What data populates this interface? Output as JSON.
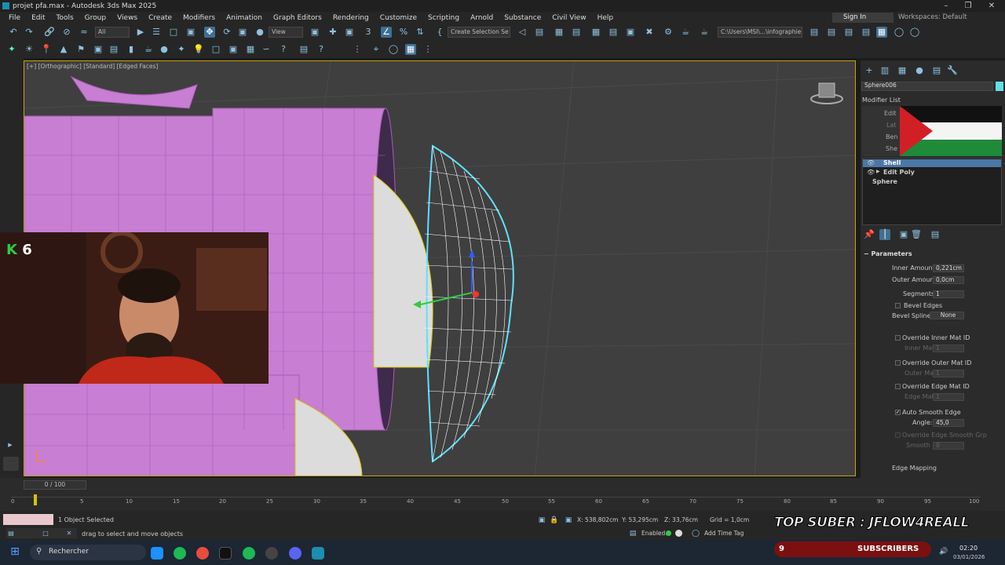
{
  "window": {
    "title": "projet pfa.max - Autodesk 3ds Max 2025"
  },
  "menus": [
    "File",
    "Edit",
    "Tools",
    "Group",
    "Views",
    "Create",
    "Modifiers",
    "Animation",
    "Graph Editors",
    "Rendering",
    "Customize",
    "Scripting",
    "Arnold",
    "Substance",
    "Civil View",
    "Help"
  ],
  "account": {
    "signin": "Sign In",
    "workspaces": "Workspaces:  Default"
  },
  "toolbar": {
    "filter": "All",
    "ref_coord": "View",
    "selection_set": "Create Selection Se",
    "path": "C:\\Users\\MSI\\...\\infographie"
  },
  "viewport": {
    "label": "[+] [Orthographic] [Standard] [Edged Faces]"
  },
  "webcam": {
    "count": "6"
  },
  "command_panel": {
    "object_name": "Sphere006",
    "modifier_list": "Modifier List",
    "stack": [
      "Shell",
      "Edit Poly",
      "Sphere"
    ],
    "stack_buttons": [
      "Edit",
      "Lat",
      "Ben",
      "She"
    ],
    "rollout": "Parameters",
    "inner_amount_label": "Inner Amount:",
    "inner_amount": "0,221cm",
    "outer_amount_label": "Outer Amount:",
    "outer_amount": "0,0cm",
    "segments_label": "Segments:",
    "segments": "1",
    "bevel_edges": "Bevel Edges",
    "bevel_spline_label": "Bevel Spline:",
    "bevel_spline": "None",
    "override_inner": "Override Inner Mat ID",
    "inner_mat_label": "Inner Mat ID:",
    "inner_mat": "1",
    "override_outer": "Override Outer Mat ID",
    "outer_mat_label": "Outer Mat ID:",
    "outer_mat": "1",
    "override_edge": "Override Edge Mat ID",
    "edge_mat_label": "Edge Mat ID:",
    "edge_mat": "1",
    "auto_smooth": "Auto Smooth Edge",
    "angle_label": "Angle:",
    "angle": "45,0",
    "override_smooth": "Override Edge Smooth Grp",
    "smooth_grp_label": "Smooth Grp:",
    "smooth_grp": "0",
    "edge_mapping": "Edge Mapping"
  },
  "timeline": {
    "frame": "0 / 100",
    "ticks": [
      "0",
      "5",
      "10",
      "15",
      "20",
      "25",
      "30",
      "35",
      "40",
      "45",
      "50",
      "55",
      "60",
      "65",
      "70",
      "75",
      "80",
      "85",
      "90",
      "95",
      "100"
    ]
  },
  "status": {
    "selection": "1 Object Selected",
    "prompt": "drag to select and move objects",
    "x": "X: 538,802cm",
    "y": "Y: 53,295cm",
    "z": "Z: 33,76cm",
    "grid": "Grid = 1,0cm",
    "enabled": "Enabled:",
    "add_time_tag": "Add Time Tag"
  },
  "overlay": {
    "banner": "TOP SUBER : JFLOW4REALL",
    "subs_count": "9",
    "subs_label": "SUBSCRIBERS"
  },
  "taskbar": {
    "search": "Rechercher",
    "time": "02:20",
    "date": "03/01/2026"
  },
  "colors": {
    "accent": "#1a8fb0",
    "shell_purple": "#c77ed3",
    "selection_cyan": "#5fe0ff",
    "viewport": "#3f3f3f"
  }
}
